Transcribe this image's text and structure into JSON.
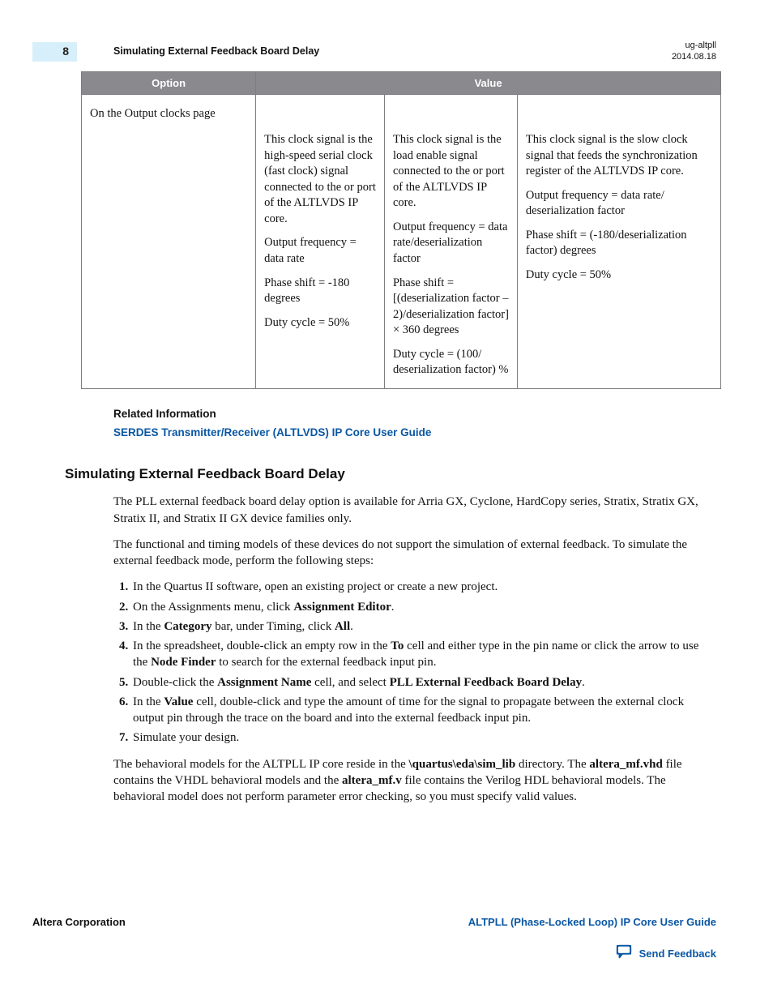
{
  "header": {
    "page_number": "8",
    "running_title": "Simulating External Feedback Board Delay",
    "doc_id": "ug-altpll",
    "date": "2014.08.18"
  },
  "table": {
    "col_option": "Option",
    "col_value": "Value",
    "row_option": "On the Output clocks page",
    "cell1": {
      "p1": "This clock signal is the high-speed serial clock (fast clock) signal connected to the   or   port of the ALTLVDS IP core.",
      "p2": "Output frequency = data rate",
      "p3": "Phase shift = -180 degrees",
      "p4": "Duty cycle = 50%"
    },
    "cell2": {
      "p1": "This clock signal is the load enable signal connected to the   or   port of the ALTLVDS IP core.",
      "p2": "Output frequency = data rate/deserializa­tion factor",
      "p3": "Phase shift = [(deserialization factor – 2)/deserializa­tion factor] × 360 degrees",
      "p4": "Duty cycle = (100/ deserialization factor) %"
    },
    "cell3": {
      "p1": "This clock signal is the slow clock signal that feeds the synchronization register of the ALTLVDS IP core.",
      "p2": "Output frequency = data rate/ deserialization factor",
      "p3": "Phase shift = (-180/deserializa­tion factor) degrees",
      "p4": "Duty cycle = 50%"
    }
  },
  "related": {
    "label": "Related Information",
    "link_text": "SERDES Transmitter/Receiver (ALTLVDS) IP Core User Guide"
  },
  "section_heading": "Simulating External Feedback Board Delay",
  "body": {
    "p1": "The PLL external feedback board delay option is available for Arria GX, Cyclone, HardCopy series, Stratix, Stratix GX, Stratix II, and Stratix II GX device families only.",
    "p2": "The functional and timing models of these devices do not support the simulation of external feedback. To simulate the external feedback mode, perform the following steps:",
    "steps": [
      "In the Quartus II software, open an existing project or create a new project.",
      "On the Assignments menu, click <b>Assignment Editor</b>.",
      "In the <b>Category</b> bar, under Timing, click <b>All</b>.",
      "In the spreadsheet, double-click an empty row in the <b>To</b> cell and either type in the pin name or click the arrow to use the <b>Node Finder</b> to search for the external feedback input pin.",
      "Double-click the <b>Assignment Name</b> cell, and select <b>PLL External Feedback Board Delay</b>.",
      "In the <b>Value</b> cell, double-click and type the amount of time for the signal to propagate between the external clock output pin through the trace on the board and into the external feedback input pin.",
      "Simulate your design."
    ],
    "p3": "The behavioral models for the ALTPLL IP core reside in the <b>\\quartus\\eda\\sim_lib</b> directory. The <b>altera_mf.vhd</b> file contains the VHDL behavioral models and the <b>altera_mf.v</b> file contains the Verilog HDL behavioral models. The behavioral model does not perform parameter error checking, so you must specify valid values."
  },
  "footer": {
    "left": "Altera Corporation",
    "right": "ALTPLL (Phase-Locked Loop) IP Core User Guide",
    "feedback_label": "Send Feedback"
  }
}
